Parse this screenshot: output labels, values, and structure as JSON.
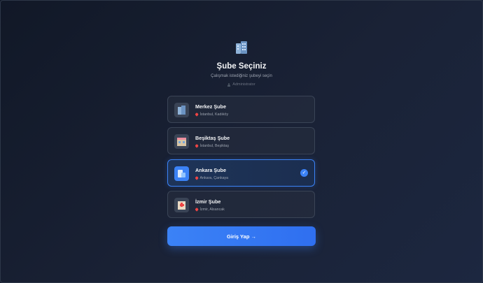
{
  "header": {
    "title": "Şube Seçiniz",
    "subtitle": "Çalışmak istediğiniz şubeyi seçin",
    "role": "Administrator"
  },
  "branches": [
    {
      "name": "Merkez Şube",
      "location": "İstanbul, Kadıköy",
      "icon": "office-building-icon",
      "selected": false
    },
    {
      "name": "Beşiktaş Şube",
      "location": "İstanbul, Beşiktaş",
      "icon": "department-store-icon",
      "selected": false
    },
    {
      "name": "Ankara Şube",
      "location": "Ankara, Çankaya",
      "icon": "city-buildings-icon",
      "selected": true
    },
    {
      "name": "İzmir Şube",
      "location": "İzmir, Alsancak",
      "icon": "hospital-building-icon",
      "selected": false
    }
  ],
  "login_button": {
    "label": "Giriş Yap →"
  },
  "colors": {
    "accent": "#3b82f6",
    "background": "#111827",
    "card_border": "#3a4456"
  }
}
